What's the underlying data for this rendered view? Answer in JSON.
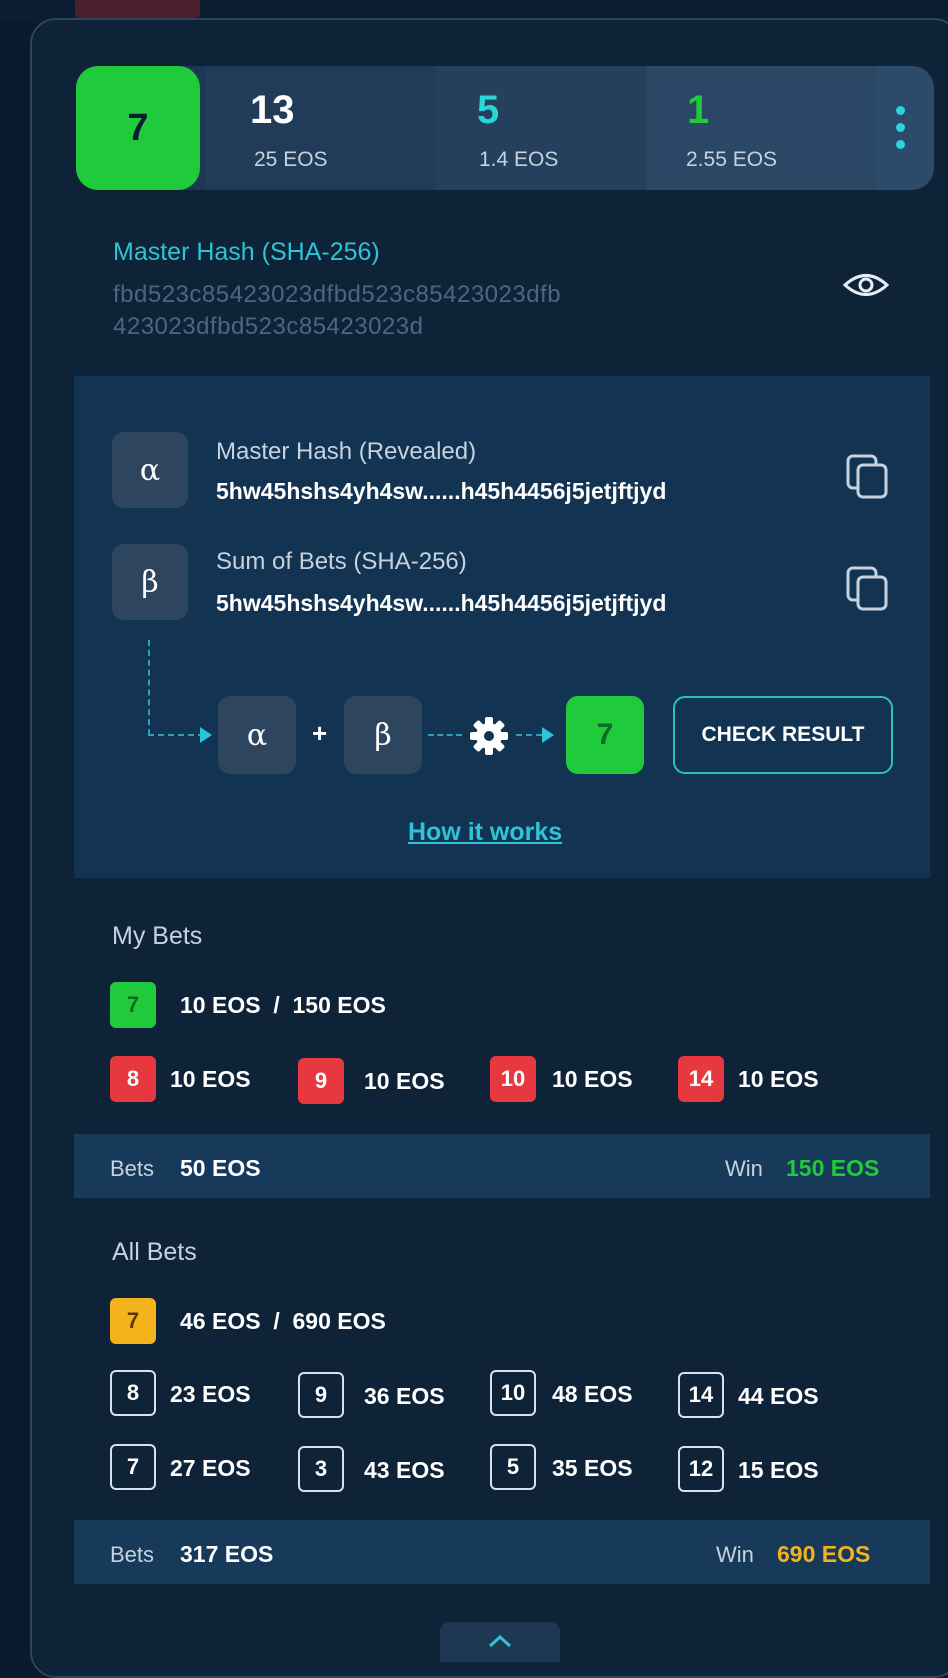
{
  "colors": {
    "accent_cyan": "#2fc3d6",
    "green": "#1fcb3a",
    "red": "#e7373f",
    "yellow": "#f4b21c",
    "panel": "#0e2238"
  },
  "current_number": "7",
  "stats": [
    {
      "number": "13",
      "sub": "25 EOS",
      "color": "#ffffff"
    },
    {
      "number": "5",
      "sub": "1.4 EOS",
      "color": "#2ad4d9"
    },
    {
      "number": "1",
      "sub": "2.55 EOS",
      "color": "#1fcb3a"
    }
  ],
  "menu_icon": "more-vertical-icon",
  "master_hash": {
    "title": "Master Hash (SHA-256)",
    "line1": "fbd523c85423023dfbd523c85423023dfb",
    "line2": "423023dfbd523c85423023d",
    "icon": "eye-icon"
  },
  "revealed": {
    "alpha_symbol": "α",
    "alpha_label": "Master Hash (Revealed)",
    "alpha_value": "5hw45hshs4yh4sw......h45h4456j5jetjftjyd",
    "beta_symbol": "β",
    "beta_label": "Sum of Bets (SHA-256)",
    "beta_value": "5hw45hshs4yh4sw......h45h4456j5jetjftjyd",
    "copy_icon": "copy-icon",
    "flow": {
      "a": "α",
      "plus": "+",
      "b": "β",
      "gear": "gear-icon",
      "result": "7"
    },
    "check_button": "CHECK RESULT",
    "how_link": "How it works"
  },
  "my_bets": {
    "title": "My Bets",
    "winning": {
      "number": "7",
      "amount": "10 EOS  /  150 EOS"
    },
    "others": [
      {
        "number": "8",
        "amount": "10 EOS"
      },
      {
        "number": "9",
        "amount": "10 EOS"
      },
      {
        "number": "10",
        "amount": "10 EOS"
      },
      {
        "number": "14",
        "amount": "10 EOS"
      }
    ],
    "bets_label": "Bets",
    "bets_value": "50 EOS",
    "win_label": "Win",
    "win_value": "150 EOS"
  },
  "all_bets": {
    "title": "All Bets",
    "winning": {
      "number": "7",
      "amount": "46 EOS  /  690 EOS"
    },
    "row1": [
      {
        "number": "8",
        "amount": "23 EOS"
      },
      {
        "number": "9",
        "amount": "36 EOS"
      },
      {
        "number": "10",
        "amount": "48 EOS"
      },
      {
        "number": "14",
        "amount": "44 EOS"
      }
    ],
    "row2": [
      {
        "number": "7",
        "amount": "27 EOS"
      },
      {
        "number": "3",
        "amount": "43 EOS"
      },
      {
        "number": "5",
        "amount": "35 EOS"
      },
      {
        "number": "12",
        "amount": "15 EOS"
      }
    ],
    "bets_label": "Bets",
    "bets_value": "317 EOS",
    "win_label": "Win",
    "win_value": "690 EOS"
  },
  "collapse_icon": "chevron-up-icon"
}
